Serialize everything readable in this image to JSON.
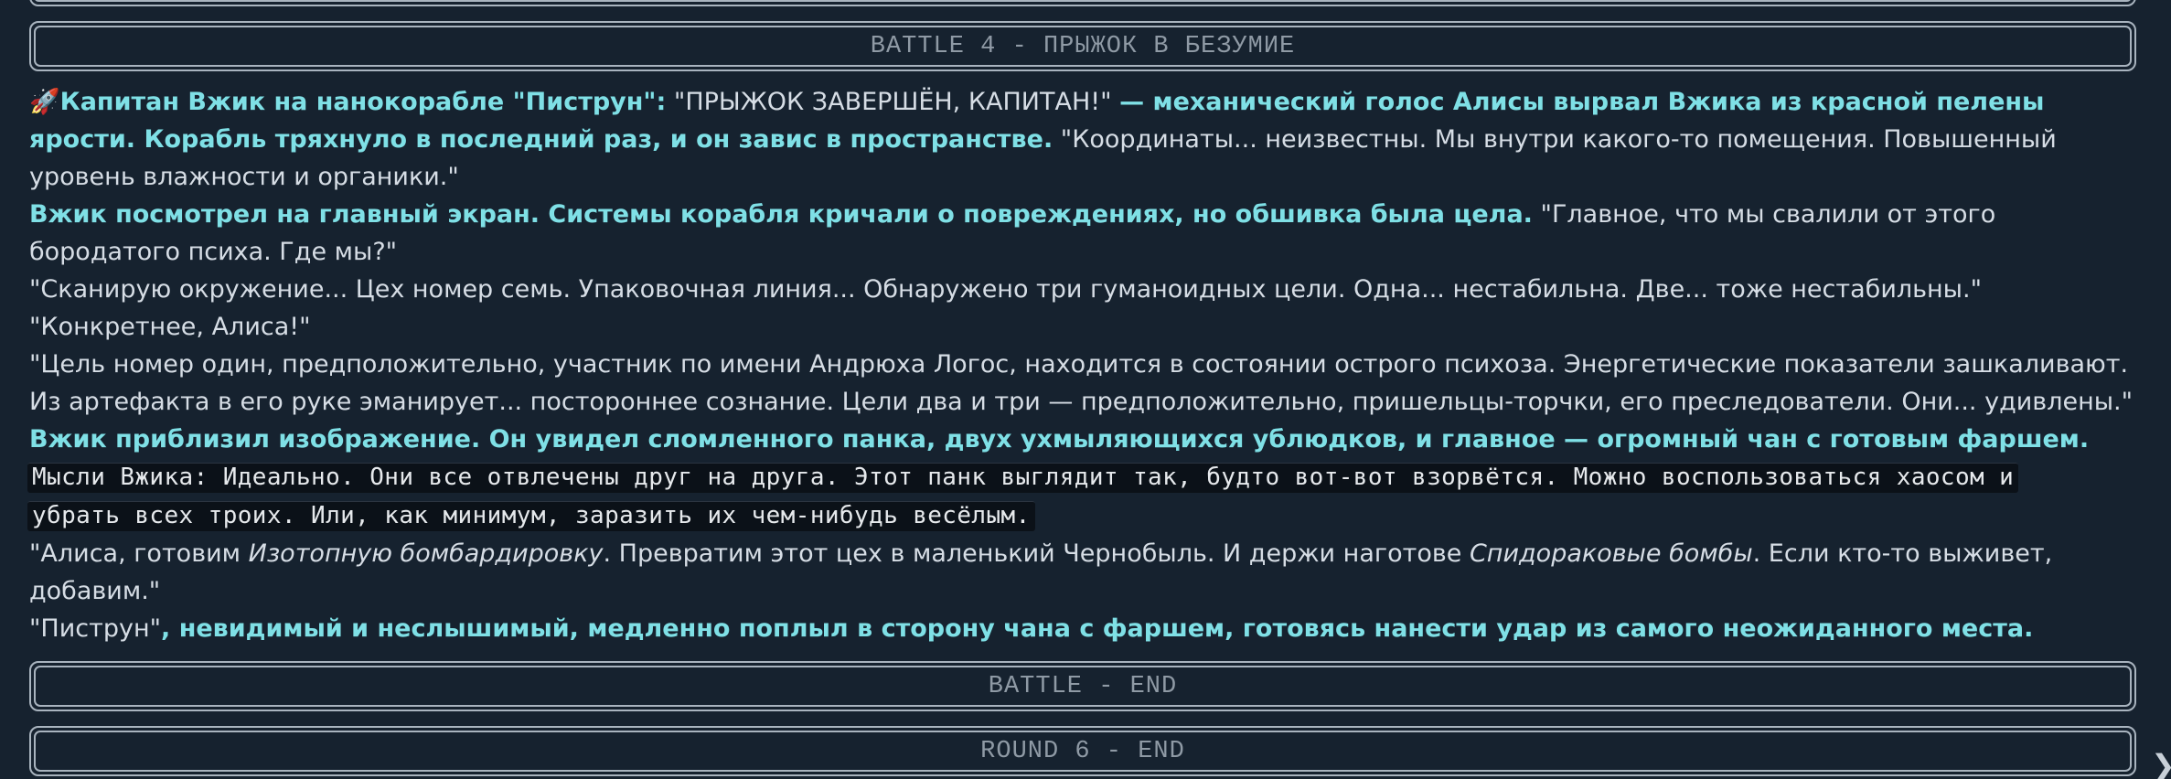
{
  "banners": {
    "top_stub": "",
    "battle_start": "BATTLE 4 - ПРЫЖОК В БЕЗУМИЕ",
    "battle_end": "BATTLE - END",
    "round_end": "ROUND 6 - END"
  },
  "story": {
    "p1": {
      "icon": "🚀",
      "speaker": "Капитан Вжик на нанокорабле \"Пиструн\":",
      "quote": " \"ПРЫЖОК ЗАВЕРШЁН, КАПИТАН!\" ",
      "narration": "— механический голос Алисы вырвал Вжика из красной пелены ярости. Корабль тряхнуло в последний раз, и он завис в пространстве.",
      "quote2": " \"Координаты... неизвестны. Мы внутри какого-то помещения. Повышенный уровень влажности и органики.\""
    },
    "p2": {
      "narration": "Вжик посмотрел на главный экран. Системы корабля кричали о повреждениях, но обшивка была цела.",
      "quote": " \"Главное, что мы свалили от этого бородатого психа. Где мы?\""
    },
    "p3": "\"Сканирую окружение... Цех номер семь. Упаковочная линия... Обнаружено три гуманоидных цели. Одна... нестабильна. Две... тоже нестабильны.\"",
    "p4": "\"Конкретнее, Алиса!\"",
    "p5": "\"Цель номер один, предположительно, участник по имени Андрюха Логос, находится в состоянии острого психоза. Энергетические показатели зашкаливают. Из артефакта в его руке эманирует... постороннее сознание. Цели два и три — предположительно, пришельцы-торчки, его преследователи. Они... удивлены.\"",
    "p6": "Вжик приблизил изображение. Он увидел сломленного панка, двух ухмыляющихся ублюдков, и главное — огромный чан с готовым фаршем.",
    "thought": {
      "line1": "Мысли Вжика: Идеально. Они все отвлечены друг на друга. Этот панк выглядит так, будто вот-вот взорвётся. Можно воспользоваться хаосом и",
      "line2": "убрать всех троих. Или, как минимум, заразить их чем-нибудь весёлым."
    },
    "p7": {
      "a": "\"Алиса, готовим ",
      "em1": "Изотопную бомбардировку",
      "b": ". Превратим этот цех в маленький Чернобыль. И держи наготове ",
      "em2": "Спидораковые бомбы",
      "c": ". Если кто-то выживет, добавим.\""
    },
    "p8": {
      "quote": "\"Пиструн\"",
      "narration": ", невидимый и неслышимый, медленно поплыл в сторону чана с фаршем, готовясь нанести удар из самого неожиданного места."
    }
  },
  "nav": {
    "next_glyph": "❯"
  }
}
